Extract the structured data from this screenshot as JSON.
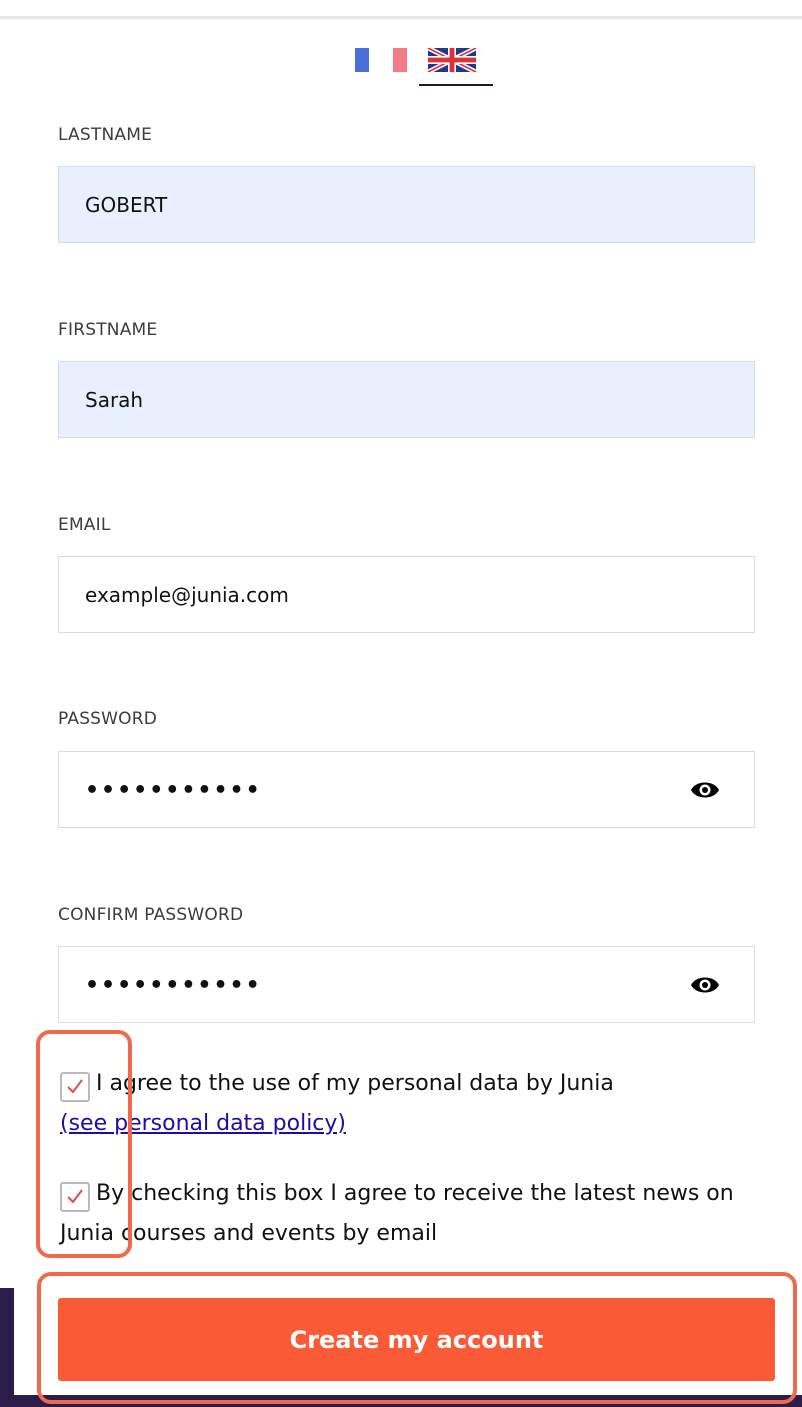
{
  "languages": [
    {
      "code": "fr",
      "icon": "french-flag-icon",
      "selected": false
    },
    {
      "code": "en",
      "icon": "uk-flag-icon",
      "selected": true
    }
  ],
  "form": {
    "lastname": {
      "label": "LASTNAME",
      "value": "GOBERT"
    },
    "firstname": {
      "label": "FIRSTNAME",
      "value": "Sarah"
    },
    "email": {
      "label": "EMAIL",
      "placeholder": "example@junia.com"
    },
    "password": {
      "label": "PASSWORD",
      "masked_value": "•••••••••••",
      "toggle_icon": "eye-icon"
    },
    "confirm_password": {
      "label": "CONFIRM PASSWORD",
      "masked_value": "•••••••••••",
      "toggle_icon": "eye-icon"
    },
    "consent_personal_data": {
      "checked": true,
      "text": "I agree to the use of my personal data by Junia",
      "link_text": "(see personal data policy)"
    },
    "consent_newsletter": {
      "checked": true,
      "text": "By checking this box I agree to receive the latest news on Junia courses and events by email"
    },
    "submit_label": "Create my account"
  },
  "colors": {
    "accent": "#fb5a37",
    "highlight_outline": "#ef6a4a",
    "autofill_background": "#e8f0fe",
    "link": "#1a0dab"
  }
}
